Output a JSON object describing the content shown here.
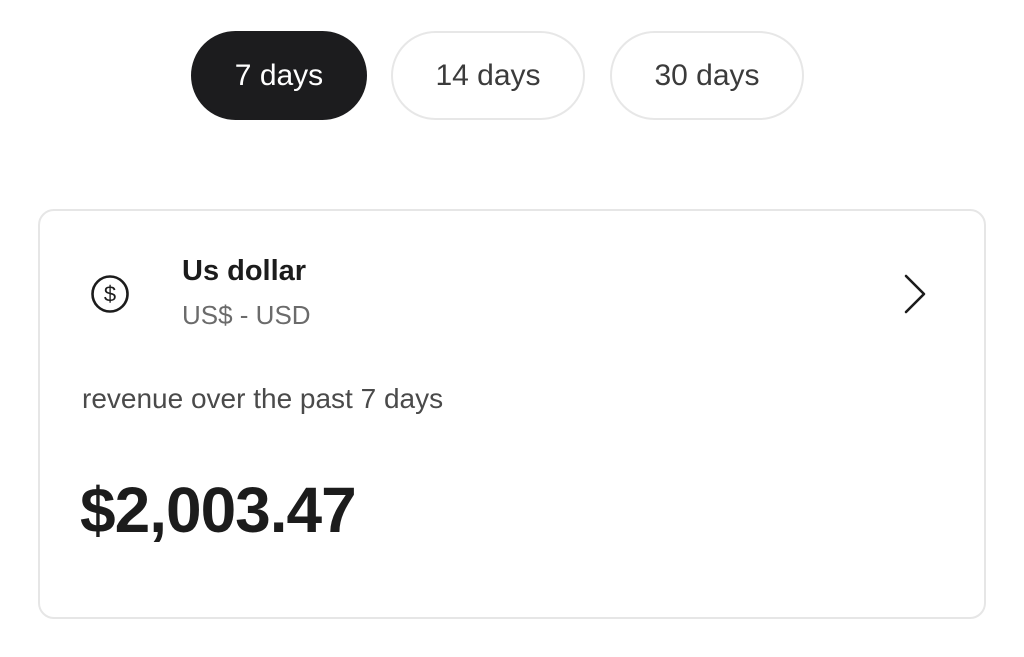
{
  "period_tabs": {
    "items": [
      {
        "label": "7 days",
        "selected": true
      },
      {
        "label": "14 days",
        "selected": false
      },
      {
        "label": "30 days",
        "selected": false
      }
    ]
  },
  "currency_card": {
    "icon": "dollar-circle-icon",
    "name": "Us dollar",
    "code": "US$ - USD",
    "chevron_icon": "chevron-right-icon",
    "revenue_label": "revenue over the past 7 days",
    "revenue_amount": "$2,003.47"
  },
  "colors": {
    "active_pill_bg": "#1c1c1e",
    "active_pill_text": "#ffffff",
    "inactive_pill_border": "#e7e7e7",
    "card_border": "#e6e6e6",
    "secondary_text": "#6b6b6b"
  }
}
